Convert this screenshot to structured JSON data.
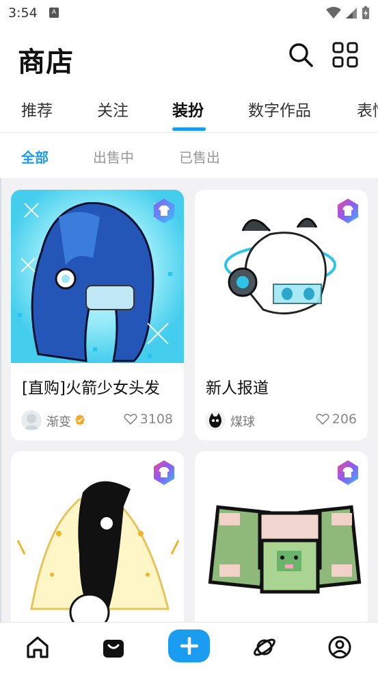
{
  "status_bar": {
    "time": "3:54",
    "notification_icon": "app-notification-icon"
  },
  "header": {
    "title": "商店",
    "search_icon": "search-icon",
    "grid_icon": "grid-icon"
  },
  "tabs": [
    "推荐",
    "关注",
    "装扮",
    "数字作品",
    "表情"
  ],
  "active_tab": "装扮",
  "subtabs": [
    "全部",
    "出售中",
    "已售出"
  ],
  "active_subtab": "全部",
  "items": [
    {
      "name": "[直购]火箭少女头发",
      "author": "渐变",
      "verified": true,
      "likes": "3108",
      "badge_icon": "outfit-badge-icon"
    },
    {
      "name": "新人报道",
      "author": "煤球",
      "verified": false,
      "likes": "206",
      "badge_icon": "outfit-badge-icon"
    },
    {
      "name": "",
      "author": "",
      "likes": "",
      "badge_icon": "outfit-badge-icon"
    },
    {
      "name": "",
      "author": "",
      "likes": "",
      "badge_icon": "outfit-badge-icon"
    }
  ],
  "bottom_nav": [
    "home-icon",
    "shop-bag-icon",
    "add-icon",
    "planet-icon",
    "profile-icon"
  ],
  "colors": {
    "accent": "#1a9cf0",
    "badge_gradient_start": "#8b5cf6",
    "badge_gradient_end": "#38bdf8"
  }
}
